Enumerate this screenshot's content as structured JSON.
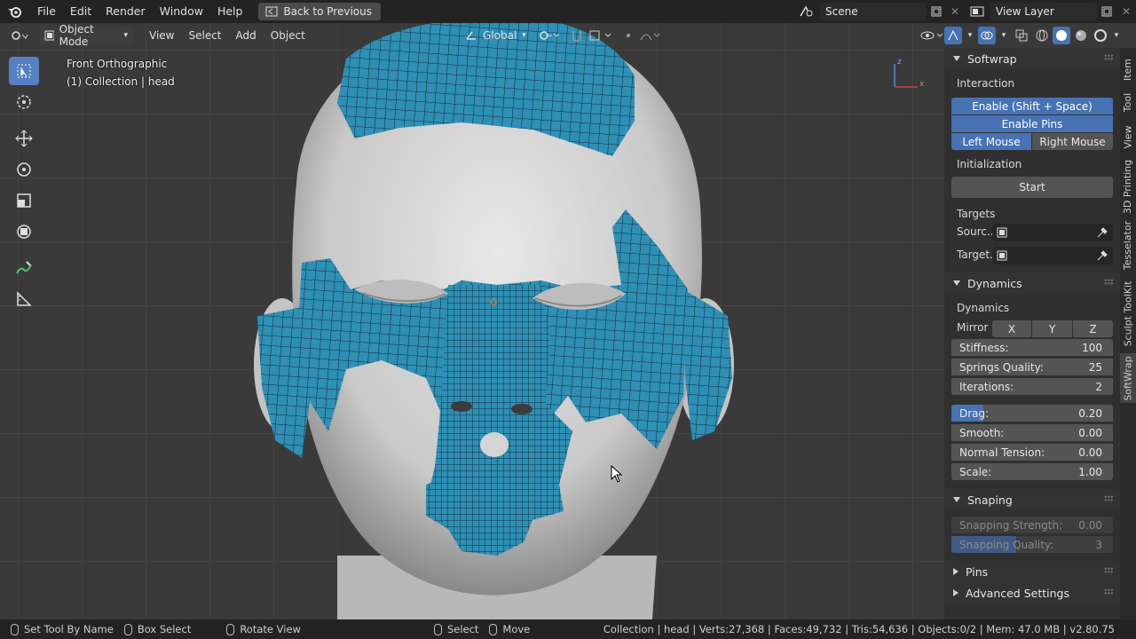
{
  "topbar": {
    "menus": [
      "File",
      "Edit",
      "Render",
      "Window",
      "Help"
    ],
    "back_label": "Back to Previous",
    "scene_label": "Scene",
    "view_layer_label": "View Layer"
  },
  "viewport_header": {
    "mode_label": "Object Mode",
    "menus": [
      "View",
      "Select",
      "Add",
      "Object"
    ],
    "transform_label": "Global"
  },
  "viewport_info": {
    "view_name": "Front Orthographic",
    "collection": "(1) Collection | head"
  },
  "gizmo": {
    "z": "z",
    "x": "x"
  },
  "sidebar_tabs": [
    "Item",
    "Tool",
    "View",
    "3D Printing",
    "Tesselator",
    "Sculpt ToolKit",
    "SoftWrap"
  ],
  "softwrap": {
    "title": "Softwrap",
    "interaction_label": "Interaction",
    "enable_label": "Enable (Shift + Space)",
    "pins_label": "Enable Pins",
    "left_mouse": "Left Mouse",
    "right_mouse": "Right Mouse",
    "init_label": "Initialization",
    "start_label": "Start",
    "targets_label": "Targets",
    "source_label": "Sourc..",
    "target_label": "Target.."
  },
  "dynamics": {
    "title": "Dynamics",
    "sub_label": "Dynamics",
    "mirror_label": "Mirror",
    "mirror_axes": [
      "X",
      "Y",
      "Z"
    ],
    "stiffness": {
      "label": "Stiffness:",
      "value": "100"
    },
    "springs": {
      "label": "Springs Quality:",
      "value": "25"
    },
    "iterations": {
      "label": "Iterations:",
      "value": "2"
    },
    "drag": {
      "label": "Drag:",
      "value": "0.20",
      "fraction": 0.2
    },
    "smooth": {
      "label": "Smooth:",
      "value": "0.00"
    },
    "normal_tension": {
      "label": "Normal Tension:",
      "value": "0.00"
    },
    "scale": {
      "label": "Scale:",
      "value": "1.00"
    }
  },
  "snaping": {
    "title": "Snaping",
    "strength": {
      "label": "Snapping Strength:",
      "value": "0.00"
    },
    "quality": {
      "label": "Snapping Quality:",
      "value": "3",
      "fraction": 0.4
    }
  },
  "pins": {
    "title": "Pins"
  },
  "advanced": {
    "title": "Advanced Settings"
  },
  "statusbar": {
    "set_tool": "Set Tool By Name",
    "box_select": "Box Select",
    "rotate_view": "Rotate View",
    "select": "Select",
    "move": "Move",
    "stats": "Collection | head | Verts:27,368 | Faces:49,732 | Tris:54,636 | Objects:0/2 | Mem: 47.0 MB | v2.80.75"
  },
  "colors": {
    "accent": "#4772b3",
    "mesh": "#2f8fb5",
    "head": "#d6d6d6"
  }
}
